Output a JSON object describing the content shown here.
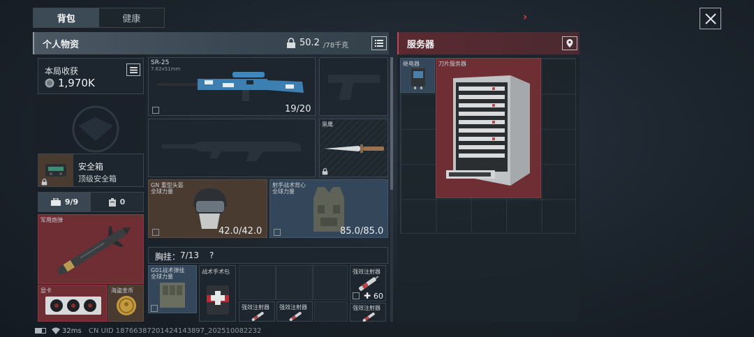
{
  "tabs": [
    {
      "label": "背包",
      "active": true
    },
    {
      "label": "健康",
      "active": false
    }
  ],
  "personal": {
    "title": "个人物资",
    "weight": "50.2",
    "weight_max": "/78千克"
  },
  "server_panel": {
    "title": "服务器"
  },
  "earnings": {
    "label": "本局收获",
    "value": "1,970K"
  },
  "weapon_primary": {
    "name": "SR-25",
    "caliber": "7.62x51mm",
    "ammo": "19/20"
  },
  "knife": {
    "name": "黑鹰"
  },
  "helmet": {
    "name": "GN 重型头盔",
    "sub": "全球力量",
    "durability": "42.0/42.0"
  },
  "vest": {
    "name": "射手战术背心",
    "sub": "全球力量",
    "durability": "85.0/85.0"
  },
  "safe_box": {
    "title": "安全箱",
    "sub": "顶级安全箱"
  },
  "inventory_tabs": {
    "backpack_count": "9/9",
    "container_count": "0"
  },
  "items": {
    "missile": "军用炮弹",
    "gpu": "显卡",
    "coin": "海盗金币",
    "rig_item": "G01战术弹挂",
    "rig_item_sub": "全球力量",
    "medkit": "战术手术包",
    "injector": "强效注射器",
    "injector_count": "60",
    "relay": "继电器",
    "blade_server": "刀片服务器"
  },
  "chest_rig": {
    "label": "胸挂：",
    "value": "7/13",
    "help": "?"
  },
  "status_bar": {
    "ping": "32ms",
    "uid": "CN UID 18766387201424143897_202510082232"
  },
  "colors": {
    "accent_red": "#c2454d",
    "header_gray": "#4b5762",
    "server_red": "#6e2e33"
  }
}
